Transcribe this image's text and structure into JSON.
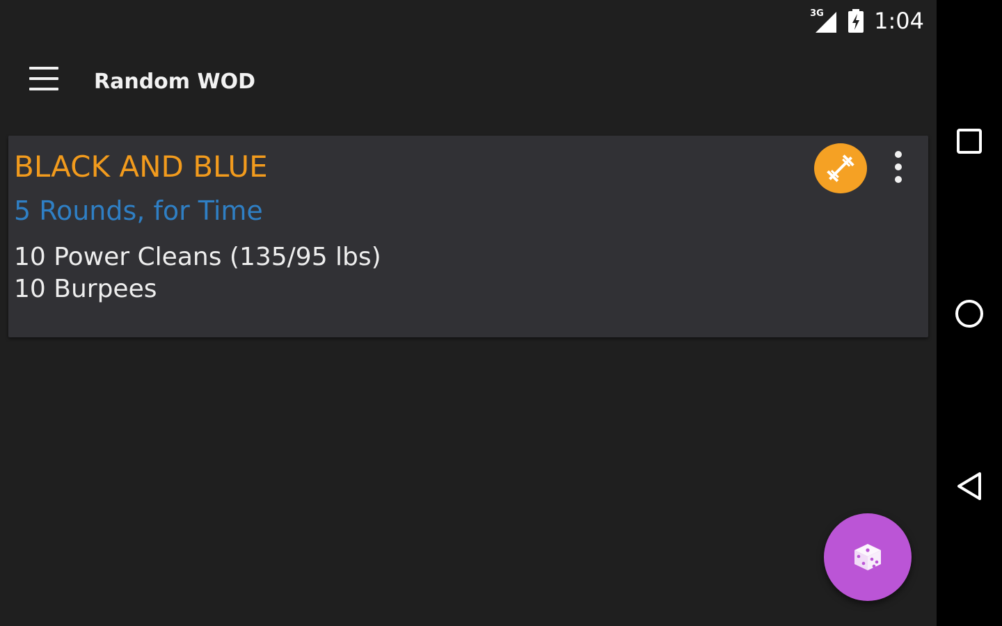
{
  "status_bar": {
    "network": "3G",
    "time": "1:04",
    "icons": [
      "signal-icon",
      "battery-icon"
    ]
  },
  "toolbar": {
    "title": "Random WOD",
    "menu_icon": "hamburger-menu-icon"
  },
  "workout_card": {
    "name": "BLACK AND BLUE",
    "scheme": "5 Rounds, for Time",
    "movements": [
      "10 Power Cleans (135/95 lbs)",
      "10 Burpees"
    ],
    "badge_icon": "barbell-icon",
    "overflow_icon": "more-vert-icon"
  },
  "fab": {
    "icon": "dice-icon"
  },
  "nav_bar": {
    "buttons": [
      "recents-icon",
      "home-icon",
      "back-icon"
    ]
  },
  "colors": {
    "background": "#1f1f1f",
    "card": "#313135",
    "wod_name": "#f29b1d",
    "wod_scheme": "#2f7fc4",
    "badge": "#f5a124",
    "fab": "#bb55d6"
  }
}
